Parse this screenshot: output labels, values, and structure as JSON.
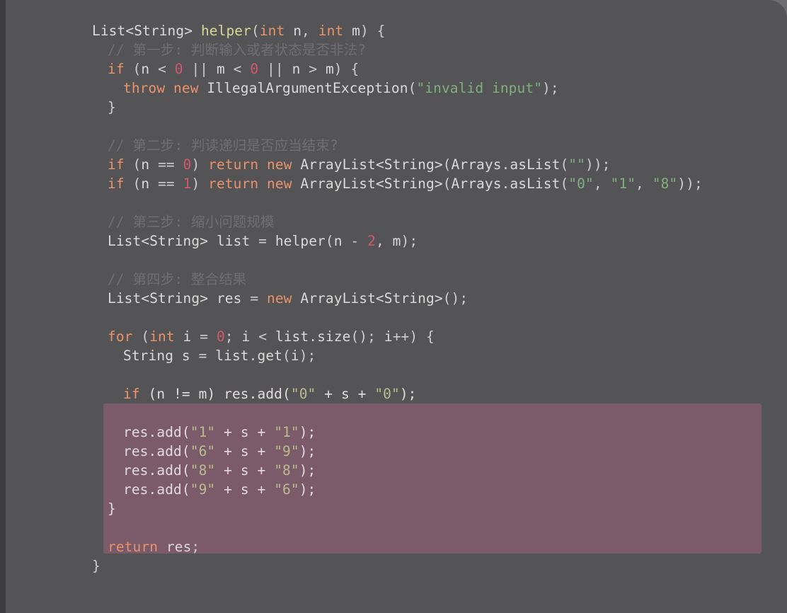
{
  "editor": {
    "language": "Java",
    "background_color": "#545356",
    "gutter_color": "#3d3c3f",
    "highlight_color": "#7b5a6a",
    "foreground_color": "#d8d6d4",
    "keyword_color": "#e8936b",
    "string_color": "#7fb07f",
    "number_color": "#cf5a6a",
    "comment_color": "#6f6e71",
    "function_color": "#d7d79a"
  },
  "code": {
    "signature": {
      "type": "List<String>",
      "name": "helper",
      "params": "(int n, int m) {"
    },
    "comments": {
      "step1": "// 第一步: 判断输入或者状态是否非法?",
      "step2": "// 第二步: 判读递归是否应当结束?",
      "step3": "// 第三步: 缩小问题规模",
      "step4": "// 第四步: 整合结果"
    },
    "lines": [
      "List<String> helper(int n, int m) {",
      "  // 第一步: 判断输入或者状态是否非法?",
      "  if (n < 0 || m < 0 || n > m) {",
      "    throw new IllegalArgumentException(\"invalid input\");",
      "  }",
      "",
      "  // 第二步: 判读递归是否应当结束?",
      "  if (n == 0) return new ArrayList<String>(Arrays.asList(\"\"));",
      "  if (n == 1) return new ArrayList<String>(Arrays.asList(\"0\", \"1\", \"8\"));",
      "",
      "  // 第三步: 缩小问题规模",
      "  List<String> list = helper(n - 2, m);",
      "",
      "  // 第四步: 整合结果",
      "  List<String> res = new ArrayList<String>();",
      "",
      "  for (int i = 0; i < list.size(); i++) {",
      "    String s = list.get(i);",
      "",
      "    if (n != m) res.add(\"0\" + s + \"0\");",
      "",
      "    res.add(\"1\" + s + \"1\");",
      "    res.add(\"6\" + s + \"9\");",
      "    res.add(\"8\" + s + \"8\");",
      "    res.add(\"9\" + s + \"6\");",
      "  }",
      "",
      "  return res;",
      "}"
    ],
    "literals": {
      "zero": "0",
      "one": "1",
      "two": "2",
      "invalid_input": "invalid input",
      "pair_0": [
        "\"0\"",
        "\"0\""
      ],
      "pair_1": [
        "\"1\"",
        "\"1\""
      ],
      "pair_6_9": [
        "\"6\"",
        "\"9\""
      ],
      "pair_8_8": [
        "\"8\"",
        "\"8\""
      ],
      "pair_9_6": [
        "\"9\"",
        "\"6\""
      ],
      "base_list": [
        "\"0\"",
        "\"1\"",
        "\"8\""
      ]
    },
    "identifiers": {
      "list": "list",
      "res": "res",
      "s": "s",
      "i": "i",
      "n": "n",
      "m": "m"
    }
  }
}
